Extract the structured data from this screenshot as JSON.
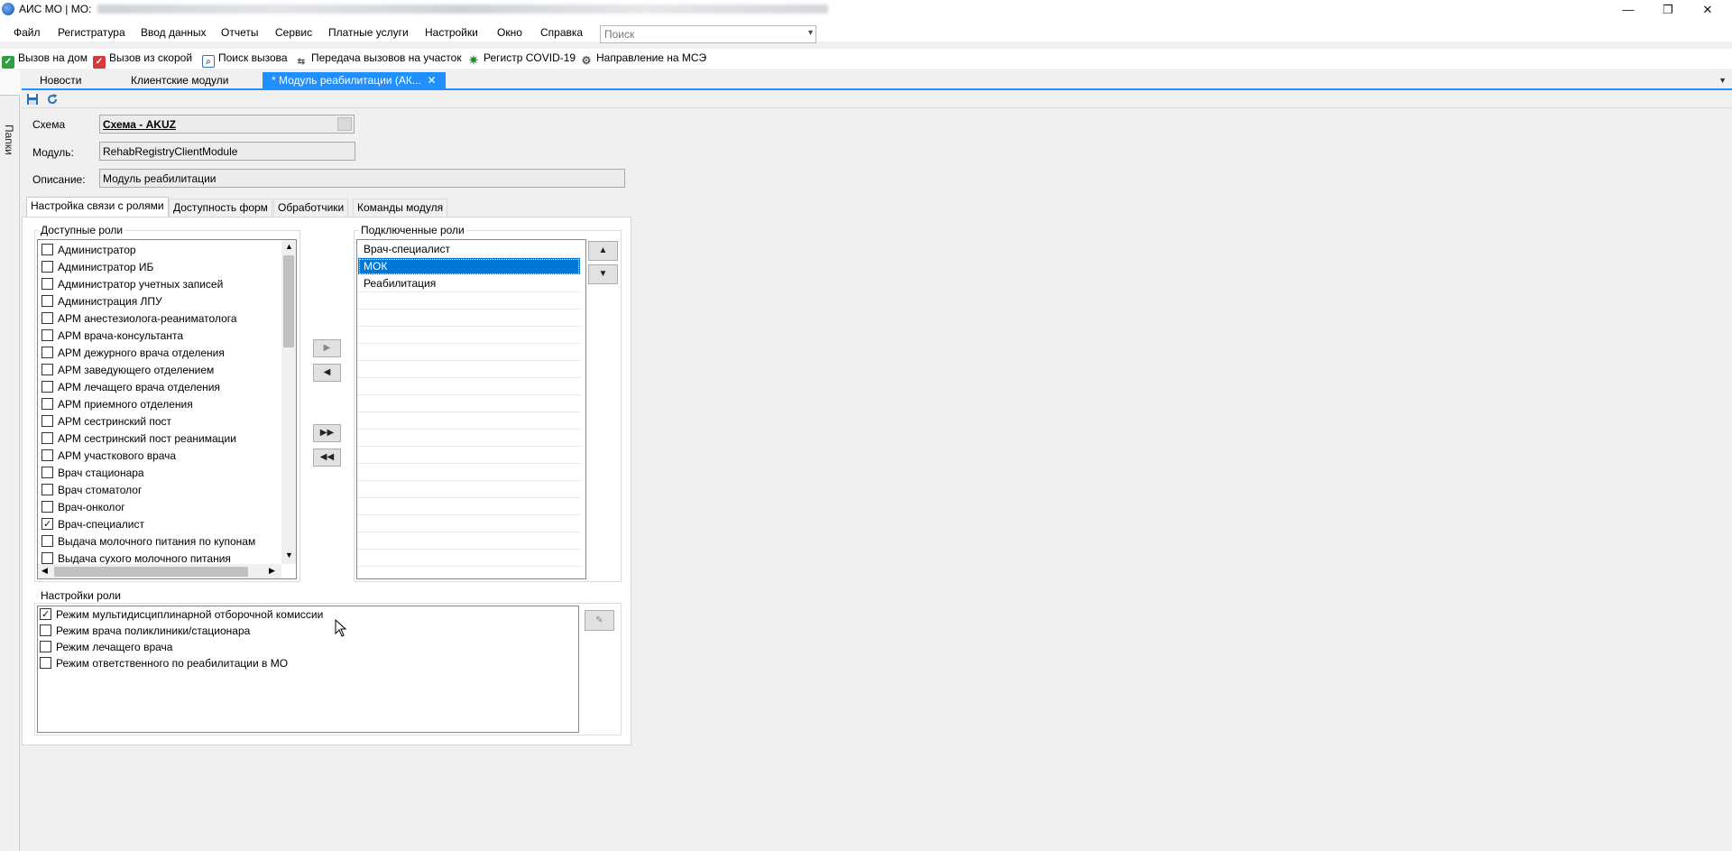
{
  "window": {
    "title": "АИС МО | МО:",
    "minimize": "—",
    "maximize": "❐",
    "close": "✕"
  },
  "menu": [
    "Файл",
    "Регистратура",
    "Ввод данных",
    "Отчеты",
    "Сервис",
    "Платные услуги",
    "Настройки",
    "Окно",
    "Справка"
  ],
  "search": {
    "placeholder": "Поиск"
  },
  "toolbar": [
    {
      "label": "Вызов на дом",
      "icon": "home-call-icon",
      "color": "#2ea043"
    },
    {
      "label": "Вызов из скорой",
      "icon": "ambulance-call-icon",
      "color": "#d63a3a"
    },
    {
      "label": "Поиск вызова",
      "icon": "search-call-icon",
      "color": "#3b6fb5"
    },
    {
      "label": "Передача вызовов на участок",
      "icon": "transfer-call-icon",
      "color": "#5a5a5a"
    },
    {
      "label": "Регистр COVID-19",
      "icon": "covid-icon",
      "color": "#2a8a2a"
    },
    {
      "label": "Направление на МСЭ",
      "icon": "mse-referral-icon",
      "color": "#555555"
    }
  ],
  "side_panel": {
    "label": "Папки"
  },
  "doc_tabs": [
    {
      "label": "Новости"
    },
    {
      "label": "Клиентские модули"
    },
    {
      "label": "* Модуль реабилитации (АК..."
    }
  ],
  "doc_tab_close": "✕",
  "form": {
    "schema_label": "Схема",
    "schema_value": "Схема - AKUZ",
    "module_label": "Модуль:",
    "module_value": "RehabRegistryClientModule",
    "description_label": "Описание:",
    "description_value": "Модуль реабилитации"
  },
  "inner_tabs": [
    "Настройка связи с ролями",
    "Доступность форм",
    "Обработчики",
    "Команды модуля"
  ],
  "available_roles": {
    "title": "Доступные роли",
    "items": [
      {
        "label": "Администратор",
        "checked": false
      },
      {
        "label": "Администратор ИБ",
        "checked": false
      },
      {
        "label": "Администратор учетных записей",
        "checked": false
      },
      {
        "label": "Администрация ЛПУ",
        "checked": false
      },
      {
        "label": "АРМ анестезиолога-реаниматолога",
        "checked": false
      },
      {
        "label": "АРМ врача-консультанта",
        "checked": false
      },
      {
        "label": "АРМ дежурного врача отделения",
        "checked": false
      },
      {
        "label": "АРМ заведующего отделением",
        "checked": false
      },
      {
        "label": "АРМ лечащего врача отделения",
        "checked": false
      },
      {
        "label": "АРМ приемного отделения",
        "checked": false
      },
      {
        "label": "АРМ сестринский пост",
        "checked": false
      },
      {
        "label": "АРМ сестринский пост реанимации",
        "checked": false
      },
      {
        "label": "АРМ участкового врача",
        "checked": false
      },
      {
        "label": "Врач стационара",
        "checked": false
      },
      {
        "label": "Врач стоматолог",
        "checked": false
      },
      {
        "label": "Врач-онколог",
        "checked": false
      },
      {
        "label": "Врач-специалист",
        "checked": true
      },
      {
        "label": "Выдача молочного питания по купонам",
        "checked": false
      },
      {
        "label": "Выдача сухого молочного питания",
        "checked": false
      }
    ]
  },
  "connected_roles": {
    "title": "Подключенные роли",
    "items": [
      {
        "label": "Врач-специалист",
        "selected": false
      },
      {
        "label": "МОК",
        "selected": true
      },
      {
        "label": "Реабилитация",
        "selected": false
      }
    ]
  },
  "role_settings": {
    "title": "Настройки роли",
    "items": [
      {
        "label": "Режим мультидисциплинарной отборочной комиссии",
        "checked": true
      },
      {
        "label": "Режим врача поликлиники/стационара",
        "checked": false
      },
      {
        "label": "Режим лечащего врача",
        "checked": false
      },
      {
        "label": "Режим ответственного по реабилитации в МО",
        "checked": false
      }
    ]
  },
  "colors": {
    "accent": "#1e90ff",
    "selection": "#0078d7"
  }
}
